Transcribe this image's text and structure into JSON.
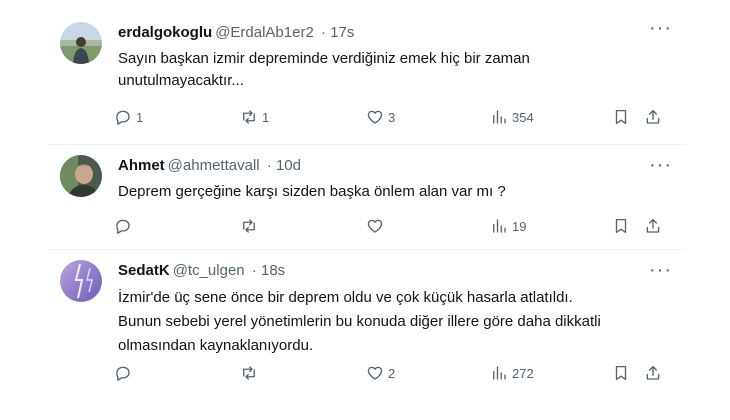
{
  "tweets": [
    {
      "name": "erdalgokoglu",
      "handle": "@ErdalAb1er2",
      "time": "· 17s",
      "text": "Sayın başkan izmir depreminde verdiğiniz emek hiç bir zaman unutulmayacaktır...",
      "replies": "1",
      "retweets": "1",
      "likes": "3",
      "views": "354"
    },
    {
      "name": "Ahmet",
      "handle": "@ahmettavall",
      "time": "· 10d",
      "text": "Deprem gerçeğine karşı sizden başka önlem alan var mı ?",
      "replies": "",
      "retweets": "",
      "likes": "",
      "views": "19"
    },
    {
      "name": "SedatK",
      "handle": "@tc_ulgen",
      "time": "· 18s",
      "text": "İzmir'de üç sene önce bir deprem oldu ve çok küçük hasarla atlatıldı. Bunun sebebi yerel yönetimlerin bu konuda diğer illere göre daha dikkatli olmasından kaynaklanıyordu.",
      "replies": "",
      "retweets": "",
      "likes": "2",
      "views": "272"
    }
  ],
  "more_glyph": "···",
  "colors": {
    "secondary_text": "#536471",
    "primary_text": "#0f1419",
    "divider": "#eff3f4"
  },
  "icons": [
    "reply-icon",
    "retweet-icon",
    "like-icon",
    "views-icon",
    "bookmark-icon",
    "share-icon",
    "more-icon"
  ]
}
